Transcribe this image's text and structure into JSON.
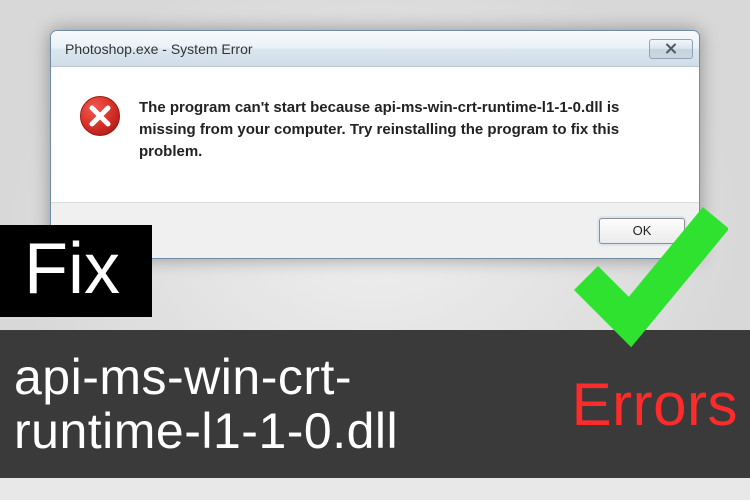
{
  "dialog": {
    "title": "Photoshop.exe - System Error",
    "message": "The program can't start because api-ms-win-crt-runtime-l1-1-0.dll is missing from your computer. Try reinstalling the program to fix this problem.",
    "ok_label": "OK"
  },
  "overlay": {
    "fix_label": "Fix",
    "filename": "api-ms-win-crt-runtime-l1-1-0.dll",
    "errors_label": "Errors"
  },
  "colors": {
    "error_red": "#d9322a",
    "check_green": "#2fe22f",
    "strip_bg": "#3a3a3a",
    "errors_text": "#ff2a2a"
  }
}
